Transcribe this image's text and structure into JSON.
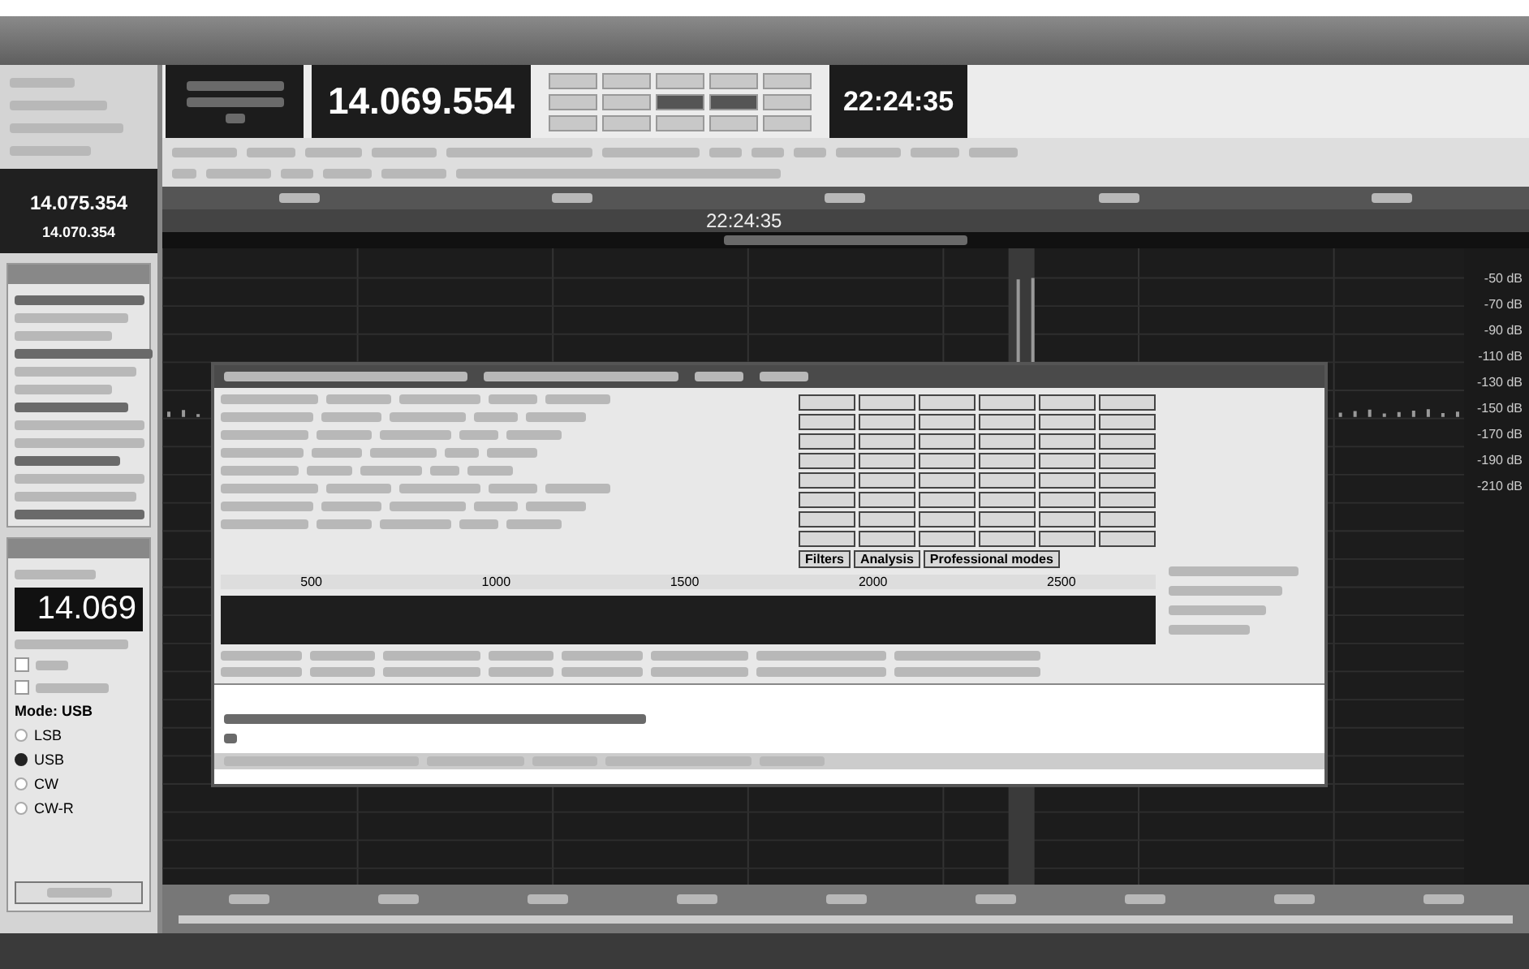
{
  "main_display": {
    "frequency": "14.069.554",
    "clock": "22:24:35"
  },
  "side_panel": {
    "frequencies": [
      "14.075.354",
      "14.070.354"
    ]
  },
  "spectrum": {
    "time": "22:24:35",
    "scale": [
      "-50 dB",
      "-70 dB",
      "-90 dB",
      "-110 dB",
      "-130 dB",
      "-150 dB",
      "-170 dB",
      "-190 dB",
      "-210 dB"
    ]
  },
  "vfo_panel": {
    "frequency": "14.069",
    "options": [
      {
        "checked": false
      },
      {
        "checked": false
      }
    ],
    "mode_label": "Mode: USB",
    "modes": [
      {
        "label": "LSB",
        "selected": false
      },
      {
        "label": "USB",
        "selected": true
      },
      {
        "label": "CW",
        "selected": false
      },
      {
        "label": "CW-R",
        "selected": false
      }
    ]
  },
  "digital_window": {
    "macro_buttons": [
      "Filters",
      "Analysis",
      "Professional modes"
    ],
    "waterfall_ticks": [
      "500",
      "1000",
      "1500",
      "2000",
      "2500"
    ]
  }
}
